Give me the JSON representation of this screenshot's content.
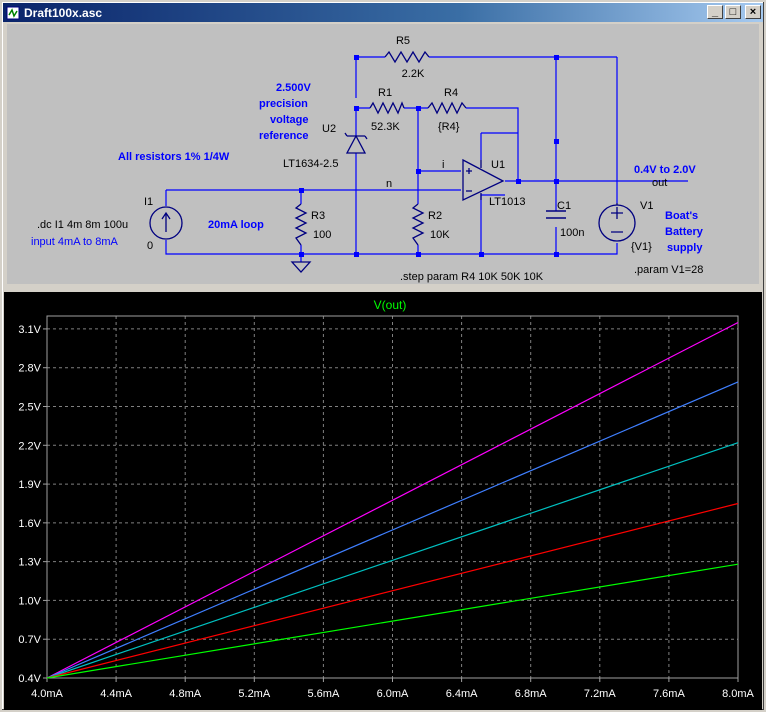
{
  "window": {
    "title": "Draft100x.asc",
    "buttons": {
      "minimize": "_",
      "maximize": "□",
      "close": "×"
    }
  },
  "schematic": {
    "components": {
      "R5": {
        "ref": "R5",
        "value": "2.2K"
      },
      "R1": {
        "ref": "R1",
        "value": "52.3K"
      },
      "R4": {
        "ref": "R4",
        "value": "{R4}"
      },
      "R3": {
        "ref": "R3",
        "value": "100"
      },
      "R2": {
        "ref": "R2",
        "value": "10K"
      },
      "U1": {
        "ref": "U1",
        "value": "LT1013"
      },
      "U2": {
        "ref": "U2",
        "value": "LT1634-2.5"
      },
      "C1": {
        "ref": "C1",
        "value": "100n"
      },
      "I1": {
        "ref": "I1",
        "value": "0"
      },
      "V1": {
        "ref": "V1",
        "value": "{V1}"
      }
    },
    "notes": {
      "reference_lines": [
        "2.500V",
        "precision",
        "voltage",
        "reference"
      ],
      "resistors": "All resistors 1% 1/4W",
      "dc_cmd": ".dc I1 4m 8m 100u",
      "input": "input 4mA to 8mA",
      "loop": "20mA loop",
      "output_range": "0.4V to 2.0V",
      "battery_lines": [
        "Boat's",
        "Battery",
        "supply"
      ],
      "step_cmd": ".step param R4 10K 50K 10K",
      "param_cmd": ".param V1=28"
    },
    "nets": {
      "n": "n",
      "i": "i",
      "out": "out"
    },
    "colors": {
      "wire": "#0000ff",
      "component": "#000080",
      "label": "#000000",
      "note": "#0000ff",
      "background": "#c0c0c0"
    }
  },
  "plot": {
    "title": "V(out)",
    "colors": {
      "background": "#000000",
      "grid": "#808080",
      "text": "#ffffff",
      "title": "#00ff00"
    }
  },
  "chart_data": {
    "type": "line",
    "title": "V(out)",
    "xlabel": "",
    "ylabel": "",
    "xlim": [
      4.0,
      8.0
    ],
    "ylim": [
      0.4,
      3.2
    ],
    "x_ticks": [
      "4.0mA",
      "4.4mA",
      "4.8mA",
      "5.2mA",
      "5.6mA",
      "6.0mA",
      "6.4mA",
      "6.8mA",
      "7.2mA",
      "7.6mA",
      "8.0mA"
    ],
    "y_ticks": [
      "0.4V",
      "0.7V",
      "1.0V",
      "1.3V",
      "1.6V",
      "1.9V",
      "2.2V",
      "2.5V",
      "2.8V",
      "3.1V"
    ],
    "grid": true,
    "series": [
      {
        "color": "#ff00ff",
        "x": [
          4.0,
          8.0
        ],
        "y": [
          0.4,
          3.15
        ]
      },
      {
        "color": "#3f7fff",
        "x": [
          4.0,
          8.0
        ],
        "y": [
          0.4,
          2.69
        ]
      },
      {
        "color": "#00c0c0",
        "x": [
          4.0,
          8.0
        ],
        "y": [
          0.4,
          2.22
        ]
      },
      {
        "color": "#ff0000",
        "x": [
          4.0,
          8.0
        ],
        "y": [
          0.4,
          1.75
        ]
      },
      {
        "color": "#00ff00",
        "x": [
          4.0,
          8.0
        ],
        "y": [
          0.4,
          1.28
        ]
      }
    ]
  }
}
